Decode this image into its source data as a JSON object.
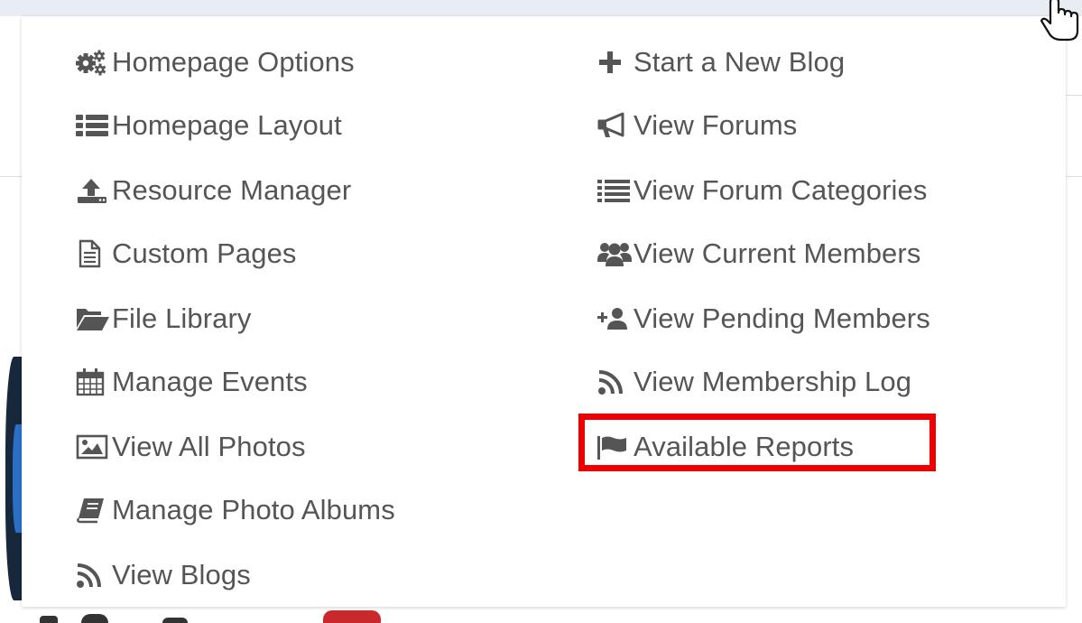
{
  "menu": {
    "left_items": [
      {
        "label": "Homepage Options",
        "icon": "gears-icon"
      },
      {
        "label": "Homepage Layout",
        "icon": "list-icon"
      },
      {
        "label": "Resource Manager",
        "icon": "upload-icon"
      },
      {
        "label": "Custom Pages",
        "icon": "file-text-icon"
      },
      {
        "label": "File Library",
        "icon": "folder-open-icon"
      },
      {
        "label": "Manage Events",
        "icon": "calendar-icon"
      },
      {
        "label": "View All Photos",
        "icon": "image-icon"
      },
      {
        "label": "Manage Photo Albums",
        "icon": "book-icon"
      },
      {
        "label": "View Blogs",
        "icon": "rss-icon"
      }
    ],
    "right_items": [
      {
        "label": "Start a New Blog",
        "icon": "plus-icon"
      },
      {
        "label": "View Forums",
        "icon": "bullhorn-icon"
      },
      {
        "label": "View Forum Categories",
        "icon": "list-lines-icon"
      },
      {
        "label": "View Current Members",
        "icon": "users-icon"
      },
      {
        "label": "View Pending Members",
        "icon": "user-plus-icon"
      },
      {
        "label": "View Membership Log",
        "icon": "rss-icon"
      },
      {
        "label": "Available Reports",
        "icon": "flag-icon"
      }
    ],
    "highlighted_item": "Available Reports",
    "highlight_color": "#ee0000",
    "text_color": "#555555"
  }
}
